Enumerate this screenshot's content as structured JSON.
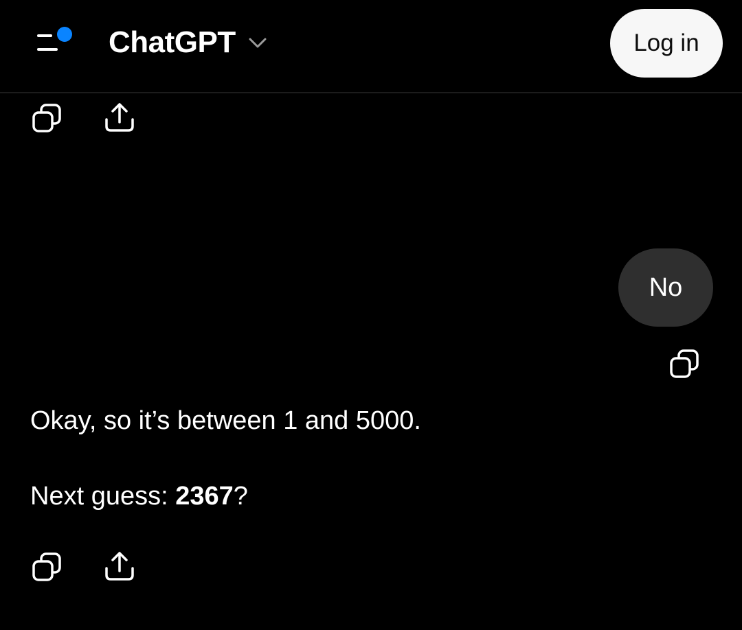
{
  "header": {
    "menu_icon": "sidebar-menu-icon",
    "notification_dot_color": "#0a84ff",
    "title": "ChatGPT",
    "chevron_icon": "chevron-down-icon",
    "login_label": "Log in"
  },
  "conversation": {
    "top_actions": {
      "copy_icon": "copy-icon",
      "share_icon": "share-icon"
    },
    "user_message": {
      "text": "No",
      "copy_icon": "copy-icon"
    },
    "assistant_message": {
      "line1": "Okay, so it’s between 1 and 5000.",
      "line2_prefix": "Next guess: ",
      "line2_bold": "2367",
      "line2_suffix": "?",
      "copy_icon": "copy-icon",
      "share_icon": "share-icon"
    }
  },
  "colors": {
    "background": "#000000",
    "user_bubble": "#2f2f2f",
    "login_button_bg": "#f7f7f7",
    "text": "#ffffff",
    "accent_dot": "#0a84ff"
  }
}
